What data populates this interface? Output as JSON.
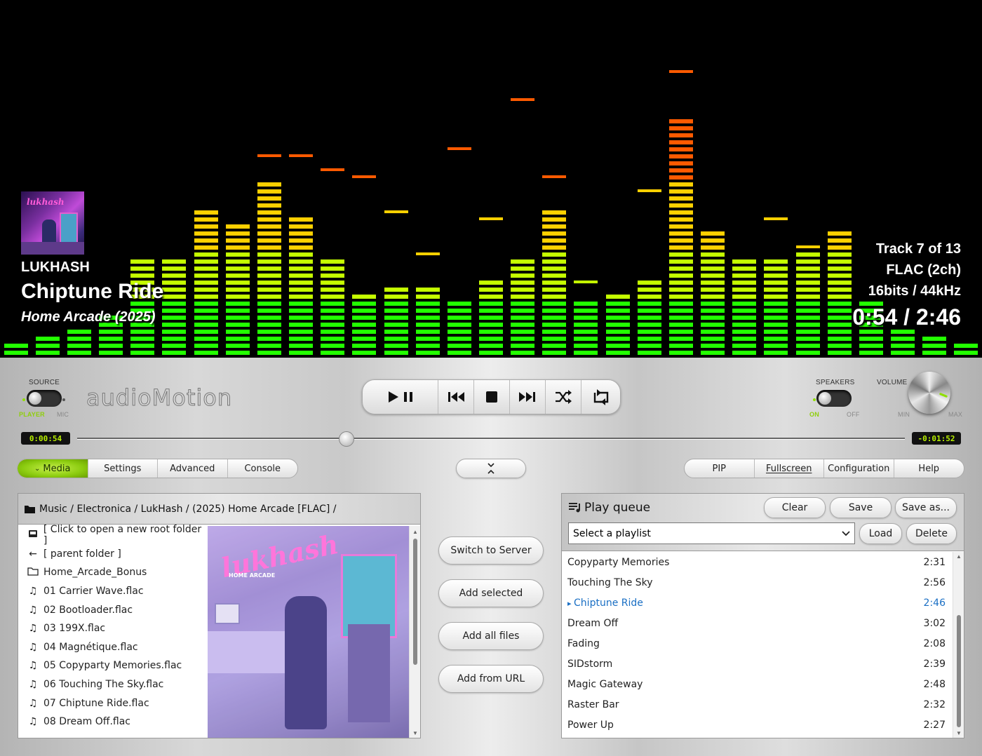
{
  "now_playing": {
    "artist": "LUKHASH",
    "title": "Chiptune Ride",
    "album": "Home Arcade (2025)",
    "track_info": "Track 7 of 13",
    "codec": "FLAC (2ch)",
    "format": "16bits / 44kHz",
    "time": "0:54 / 2:46"
  },
  "spectrum": {
    "level_steps": 50,
    "bands": [
      {
        "level": 2,
        "peak": 2
      },
      {
        "level": 3,
        "peak": 3
      },
      {
        "level": 4,
        "peak": 4
      },
      {
        "level": 6,
        "peak": 6
      },
      {
        "level": 14,
        "peak": 14
      },
      {
        "level": 14,
        "peak": 14
      },
      {
        "level": 21,
        "peak": 21
      },
      {
        "level": 19,
        "peak": 19
      },
      {
        "level": 25,
        "peak": 29
      },
      {
        "level": 20,
        "peak": 29
      },
      {
        "level": 14,
        "peak": 27
      },
      {
        "level": 9,
        "peak": 26
      },
      {
        "level": 10,
        "peak": 21
      },
      {
        "level": 10,
        "peak": 15
      },
      {
        "level": 8,
        "peak": 30
      },
      {
        "level": 11,
        "peak": 20
      },
      {
        "level": 14,
        "peak": 37
      },
      {
        "level": 21,
        "peak": 26
      },
      {
        "level": 8,
        "peak": 11
      },
      {
        "level": 9,
        "peak": 9
      },
      {
        "level": 11,
        "peak": 24
      },
      {
        "level": 34,
        "peak": 41
      },
      {
        "level": 18,
        "peak": 18
      },
      {
        "level": 14,
        "peak": 14
      },
      {
        "level": 14,
        "peak": 20
      },
      {
        "level": 15,
        "peak": 16
      },
      {
        "level": 18,
        "peak": 18
      },
      {
        "level": 8,
        "peak": 8
      },
      {
        "level": 4,
        "peak": 4
      },
      {
        "level": 3,
        "peak": 3
      },
      {
        "level": 2,
        "peak": 2
      }
    ],
    "colors": {
      "low": "#22ff00",
      "mid": "#c4ff00",
      "high": "#ffd000",
      "top": "#ff5a00"
    }
  },
  "controls": {
    "source_label": "SOURCE",
    "source_on": "PLAYER",
    "source_off": "MIC",
    "logo": "audioMotion",
    "speakers_label": "SPEAKERS",
    "speakers_on": "ON",
    "speakers_off": "OFF",
    "volume_label": "VOLUME",
    "volume_min": "MIN",
    "volume_max": "MAX",
    "elapsed": "0:00:54",
    "remaining": "-0:01:52",
    "progress": 0.325
  },
  "tabs": [
    "Media",
    "Settings",
    "Advanced",
    "Console"
  ],
  "right_tabs": [
    "PIP",
    "Fullscreen",
    "Configuration",
    "Help"
  ],
  "explorer": {
    "path": "Music / Electronica / LukHash / (2025) Home Arcade [FLAC] /",
    "items": [
      {
        "icon": "drive-icon",
        "label": "[ Click to open a new root folder ]"
      },
      {
        "icon": "back-arrow-icon",
        "label": "[ parent folder ]"
      },
      {
        "icon": "folder-icon",
        "label": "Home_Arcade_Bonus"
      },
      {
        "icon": "music-note-icon",
        "label": "01 Carrier Wave.flac"
      },
      {
        "icon": "music-note-icon",
        "label": "02 Bootloader.flac"
      },
      {
        "icon": "music-note-icon",
        "label": "03 199X.flac"
      },
      {
        "icon": "music-note-icon",
        "label": "04 Magnétique.flac"
      },
      {
        "icon": "music-note-icon",
        "label": "05 Copyparty Memories.flac"
      },
      {
        "icon": "music-note-icon",
        "label": "06 Touching The Sky.flac"
      },
      {
        "icon": "music-note-icon",
        "label": "07 Chiptune Ride.flac"
      },
      {
        "icon": "music-note-icon",
        "label": "08 Dream Off.flac"
      }
    ],
    "art_text": "lukhash",
    "art_subtext": "HOME ARCADE"
  },
  "middle_buttons": [
    "Switch to Server",
    "Add selected",
    "Add all files",
    "Add from URL"
  ],
  "queue": {
    "title": "Play queue",
    "clear": "Clear",
    "save": "Save",
    "save_as": "Save as...",
    "playlist_select": "Select a playlist",
    "load": "Load",
    "delete": "Delete",
    "tracks": [
      {
        "title": "Copyparty Memories",
        "duration": "2:31"
      },
      {
        "title": "Touching The Sky",
        "duration": "2:56"
      },
      {
        "title": "Chiptune Ride",
        "duration": "2:46",
        "current": true
      },
      {
        "title": "Dream Off",
        "duration": "3:02"
      },
      {
        "title": "Fading",
        "duration": "2:08"
      },
      {
        "title": "SIDstorm",
        "duration": "2:39"
      },
      {
        "title": "Magic Gateway",
        "duration": "2:48"
      },
      {
        "title": "Raster Bar",
        "duration": "2:32"
      },
      {
        "title": "Power Up",
        "duration": "2:27"
      }
    ]
  }
}
